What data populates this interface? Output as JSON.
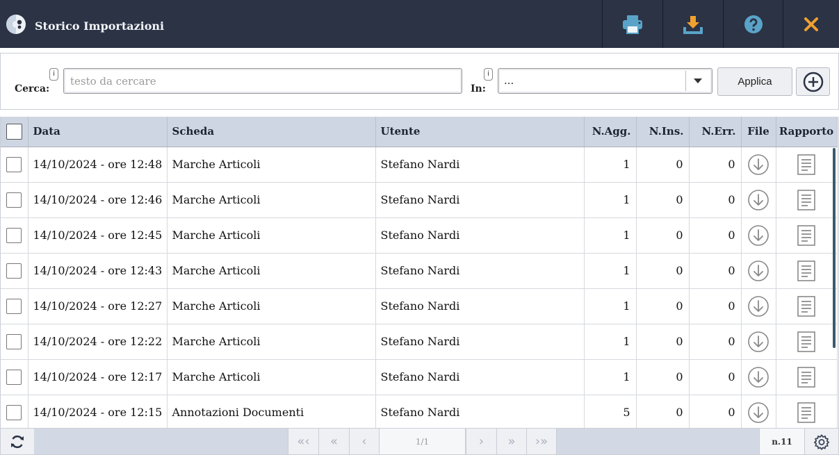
{
  "window": {
    "title": "Storico Importazioni"
  },
  "header_buttons": [
    {
      "name": "print-button",
      "icon": "printer-icon"
    },
    {
      "name": "download-button",
      "icon": "download-icon"
    },
    {
      "name": "help-button",
      "icon": "help-icon"
    },
    {
      "name": "close-button",
      "icon": "close-icon"
    }
  ],
  "search": {
    "label": "Cerca:",
    "placeholder": "testo da cercare",
    "value": "",
    "info": "i",
    "in_label": "In:",
    "in_info": "i",
    "in_value": "...",
    "apply_label": "Applica"
  },
  "table": {
    "columns": [
      "Data",
      "Scheda",
      "Utente",
      "N.Agg.",
      "N.Ins.",
      "N.Err.",
      "File",
      "Rapporto"
    ],
    "rows": [
      {
        "data": "14/10/2024 - ore 12:48",
        "scheda": "Marche Articoli",
        "utente": "Stefano Nardi",
        "agg": "1",
        "ins": "0",
        "err": "0"
      },
      {
        "data": "14/10/2024 - ore 12:46",
        "scheda": "Marche Articoli",
        "utente": "Stefano Nardi",
        "agg": "1",
        "ins": "0",
        "err": "0"
      },
      {
        "data": "14/10/2024 - ore 12:45",
        "scheda": "Marche Articoli",
        "utente": "Stefano Nardi",
        "agg": "1",
        "ins": "0",
        "err": "0"
      },
      {
        "data": "14/10/2024 - ore 12:43",
        "scheda": "Marche Articoli",
        "utente": "Stefano Nardi",
        "agg": "1",
        "ins": "0",
        "err": "0"
      },
      {
        "data": "14/10/2024 - ore 12:27",
        "scheda": "Marche Articoli",
        "utente": "Stefano Nardi",
        "agg": "1",
        "ins": "0",
        "err": "0"
      },
      {
        "data": "14/10/2024 - ore 12:22",
        "scheda": "Marche Articoli",
        "utente": "Stefano Nardi",
        "agg": "1",
        "ins": "0",
        "err": "0"
      },
      {
        "data": "14/10/2024 - ore 12:17",
        "scheda": "Marche Articoli",
        "utente": "Stefano Nardi",
        "agg": "1",
        "ins": "0",
        "err": "0"
      },
      {
        "data": "14/10/2024 - ore 12:15",
        "scheda": "Annotazioni Documenti",
        "utente": "Stefano Nardi",
        "agg": "5",
        "ins": "0",
        "err": "0"
      }
    ]
  },
  "footer": {
    "page_info": "1/1",
    "count": "n.11",
    "first": "«‹",
    "prev_fast": "«",
    "prev": "‹",
    "next": "›",
    "next_fast": "»",
    "last": "›»"
  },
  "colors": {
    "header_bg": "#2b3345",
    "accent_blue": "#5aa3c8",
    "close_orange": "#f0a030",
    "table_header_bg": "#cfd6e3"
  }
}
